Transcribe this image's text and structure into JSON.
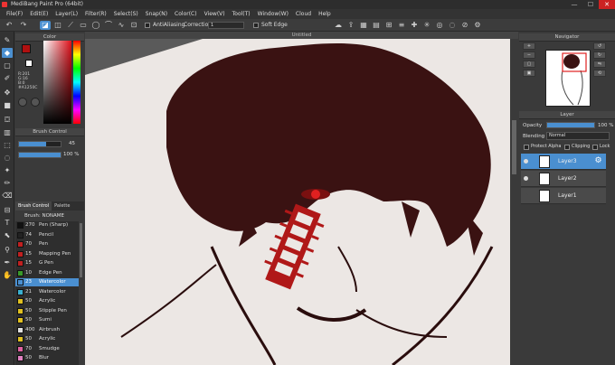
{
  "window": {
    "title": "MediBang Paint Pro (64bit)",
    "controls": [
      "—",
      "☐",
      "✕"
    ]
  },
  "menu": [
    "File(F)",
    "Edit(E)",
    "Layer(L)",
    "Filter(R)",
    "Select(S)",
    "Snap(N)",
    "Color(C)",
    "View(V)",
    "Tool(T)",
    "Window(W)",
    "Cloud",
    "Help"
  ],
  "toolbar": {
    "antialias_label": "AntiAliasing",
    "correction_label": "Correction",
    "correction_value": "1",
    "soft_edge_label": "Soft Edge"
  },
  "color_panel": {
    "title": "Color",
    "primary": "#b01010",
    "secondary": "#ffffff",
    "r": "R:201",
    "g": "G:16",
    "b": "B:0",
    "hex": "#A1250C"
  },
  "brush_control": {
    "title": "Brush Control",
    "size_value": "45",
    "opacity_value": "100 %",
    "size_pct": 65,
    "opacity_pct": 100
  },
  "brush_tabs": [
    "Brush Control",
    "Palette"
  ],
  "brush_list": {
    "title": "Brush: NONAME",
    "items": [
      {
        "size": "270",
        "name": "Pen (Sharp)",
        "color": "#111111"
      },
      {
        "size": "74",
        "name": "Pencil",
        "color": "#222222"
      },
      {
        "size": "70",
        "name": "Pen",
        "color": "#c02020"
      },
      {
        "size": "15",
        "name": "Mapping Pen",
        "color": "#c02020"
      },
      {
        "size": "15",
        "name": "G Pen",
        "color": "#c02020"
      },
      {
        "size": "10",
        "name": "Edge Pen",
        "color": "#3a9a2a"
      },
      {
        "size": "23",
        "name": "Watercolor",
        "color": "#4a8fd0"
      },
      {
        "size": "21",
        "name": "Watercolor",
        "color": "#3ab0d0"
      },
      {
        "size": "50",
        "name": "Acrylic",
        "color": "#e0c020"
      },
      {
        "size": "50",
        "name": "Stipple Pen",
        "color": "#e0c020"
      },
      {
        "size": "50",
        "name": "Sumi",
        "color": "#e0c020"
      },
      {
        "size": "400",
        "name": "Airbrush",
        "color": "#e0e0e0"
      },
      {
        "size": "50",
        "name": "Acrylic",
        "color": "#e0c020"
      },
      {
        "size": "70",
        "name": "Smudge",
        "color": "#e060a0"
      },
      {
        "size": "50",
        "name": "Blur",
        "color": "#e080c0"
      }
    ]
  },
  "document": {
    "tab": "Untitled"
  },
  "navigator": {
    "title": "Navigator"
  },
  "layer_panel": {
    "title": "Layer",
    "opacity_label": "Opacity",
    "opacity_value": "100 %",
    "blending_label": "Blending",
    "blending_value": "Normal",
    "protect_alpha": "Protect Alpha",
    "clipping": "Clipping",
    "lock": "Lock",
    "layers": [
      "Layer3",
      "Layer2",
      "Layer1"
    ]
  }
}
